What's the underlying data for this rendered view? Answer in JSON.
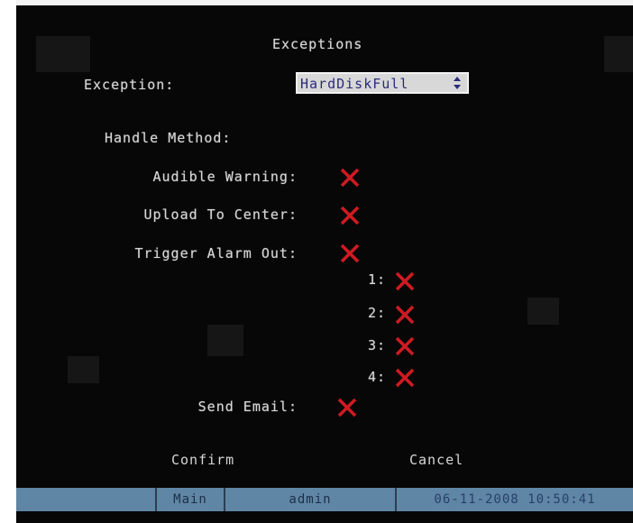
{
  "dialog": {
    "title": "Exceptions",
    "exception_label": "Exception:",
    "exception_value": "HardDiskFull",
    "handle_method_label": "Handle Method:",
    "audible_warning_label": "Audible Warning:",
    "upload_to_center_label": "Upload To Center:",
    "trigger_alarm_out_label": "Trigger Alarm Out:",
    "alarm_outputs": [
      "1:",
      "2:",
      "3:",
      "4:"
    ],
    "send_email_label": "Send Email:",
    "confirm_label": "Confirm",
    "cancel_label": "Cancel",
    "checkbox_state": "unchecked",
    "check_color": "#d01a22"
  },
  "statusbar": {
    "menu": "Main",
    "user": "admin",
    "datetime": "06-11-2008 10:50:41"
  },
  "colors": {
    "background": "#070707",
    "status_bar": "#5f86a4",
    "select_bg": "#d8d8d8"
  },
  "icons": {
    "checkbox": "red-x-icon",
    "spinner": "up-down-arrows-icon"
  }
}
